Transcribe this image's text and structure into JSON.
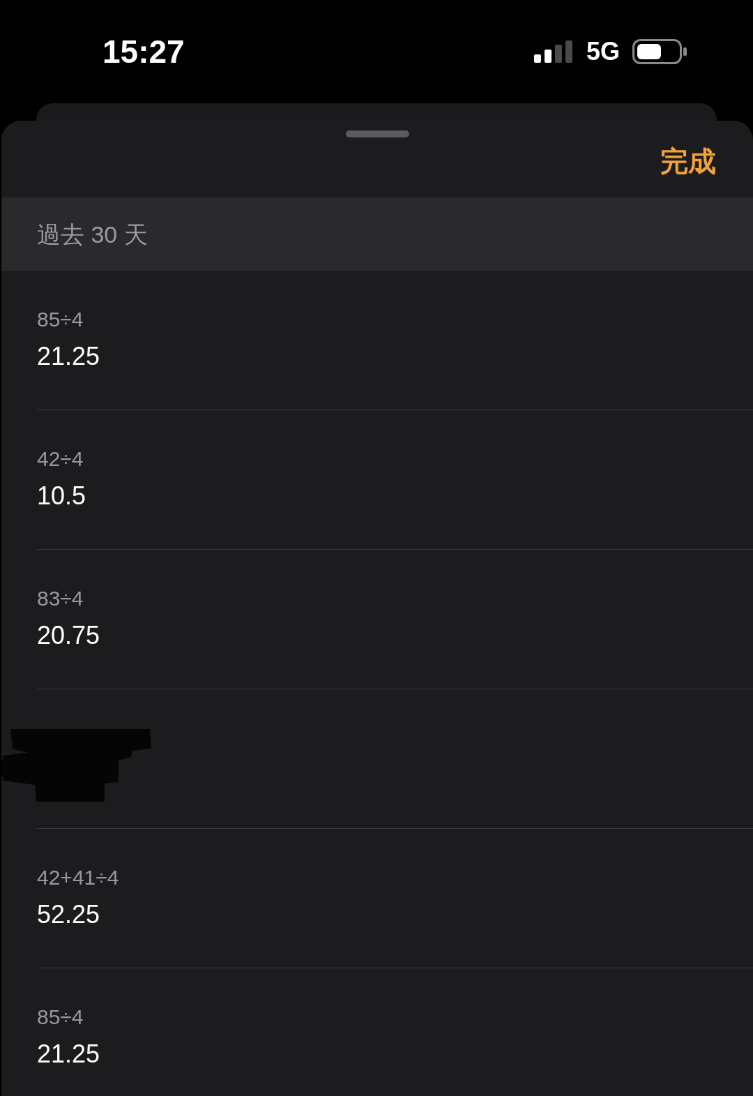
{
  "status_bar": {
    "time": "15:27",
    "network": "5G"
  },
  "sheet": {
    "done_button": "完成",
    "section_header": "過去 30 天",
    "history": [
      {
        "kind": "calculation",
        "expression": "85÷4",
        "result": "21.25"
      },
      {
        "kind": "calculation",
        "expression": "42÷4",
        "result": "10.5"
      },
      {
        "kind": "calculation",
        "expression": "83÷4",
        "result": "20.75"
      },
      {
        "kind": "redacted"
      },
      {
        "kind": "calculation",
        "expression": "42+41÷4",
        "result": "52.25"
      },
      {
        "kind": "calculation",
        "expression": "85÷4",
        "result": "21.25"
      }
    ]
  }
}
